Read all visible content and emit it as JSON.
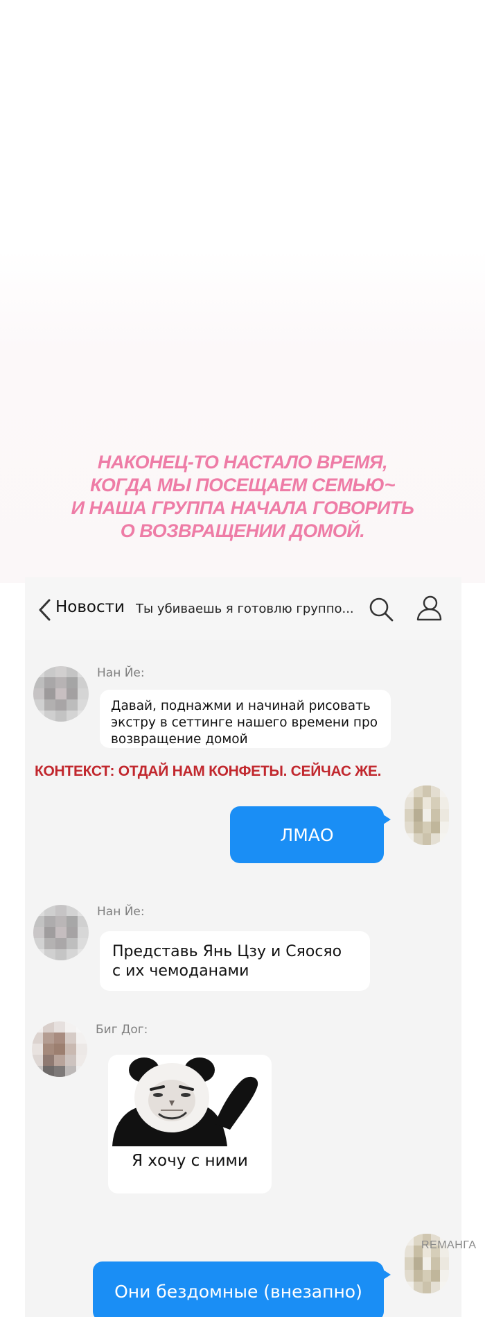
{
  "caption": {
    "lines": [
      "Наконец-то настало время,",
      "когда мы посещаем семью~",
      "и наша группа начала говорить",
      "о возвращении домой."
    ],
    "color": "#ee7ca6"
  },
  "header": {
    "back_label": "Новости",
    "chat_title": "Ты убиваешь я готовлю группо...",
    "icons": [
      "chevron-left-icon",
      "search-icon",
      "profile-icon"
    ]
  },
  "messages": [
    {
      "sender": "Нан Йе:",
      "lines": [
        "Давай, поднажми и начинай рисовать",
        "экстру в сеттинге нашего времени про",
        "возвращение домой"
      ]
    },
    {
      "self": true,
      "text": "ЛМАО"
    },
    {
      "sender": "Нан Йе:",
      "lines": [
        "Представь Янь Цзу и Сяосяо",
        "с их чемоданами"
      ]
    },
    {
      "sender": "Биг Дог:",
      "sticker": "panda-meme-sticker",
      "caption": "Я хочу с ними"
    },
    {
      "self": true,
      "text": "Они бездомные (внезапно)"
    }
  ],
  "context_note": "Контекст: Отдай нам конфеты. Сейчас же.",
  "watermark": "REМАНГА",
  "colors": {
    "accent_blue": "#1a8ef5",
    "note_red": "#c1272d",
    "panel_bg": "#f4f4f4"
  }
}
